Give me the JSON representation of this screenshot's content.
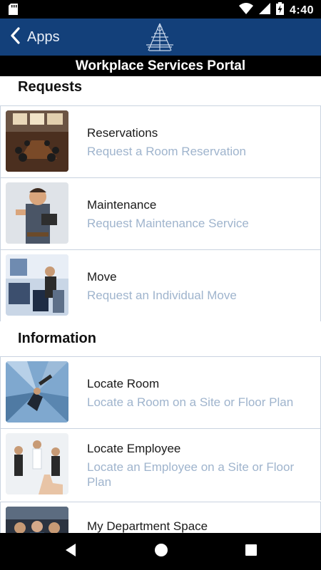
{
  "status_bar": {
    "time": "4:40",
    "icons": [
      "sd-card-icon",
      "wifi-icon",
      "signal-icon",
      "battery-charging-icon"
    ]
  },
  "app_bar": {
    "back_label": "Apps",
    "logo": "app-logo-icon"
  },
  "title": "Workplace Services Portal",
  "sections": {
    "requests": {
      "heading": "Requests",
      "items": [
        {
          "title": "Reservations",
          "subtitle": "Request a Room Reservation",
          "image": "conference-room-image"
        },
        {
          "title": "Maintenance",
          "subtitle": "Request Maintenance Service",
          "image": "maintenance-worker-image"
        },
        {
          "title": "Move",
          "subtitle": "Request an Individual Move",
          "image": "office-move-image"
        }
      ]
    },
    "information": {
      "heading": "Information",
      "items": [
        {
          "title": "Locate Room",
          "subtitle": "Locate a Room on a Site or Floor Plan",
          "image": "skyscraper-telescope-image"
        },
        {
          "title": "Locate Employee",
          "subtitle": "Locate an Employee on a Site or Floor Plan",
          "image": "employees-hand-image"
        },
        {
          "title": "My Department Space",
          "subtitle": "",
          "image": "department-team-image"
        }
      ]
    }
  },
  "nav_bar": {
    "buttons": [
      "back-triangle-icon",
      "home-circle-icon",
      "recents-square-icon"
    ]
  },
  "colors": {
    "app_bar": "#13407a",
    "subtitle": "#9fb4cd",
    "divider": "#c9d3e0"
  }
}
